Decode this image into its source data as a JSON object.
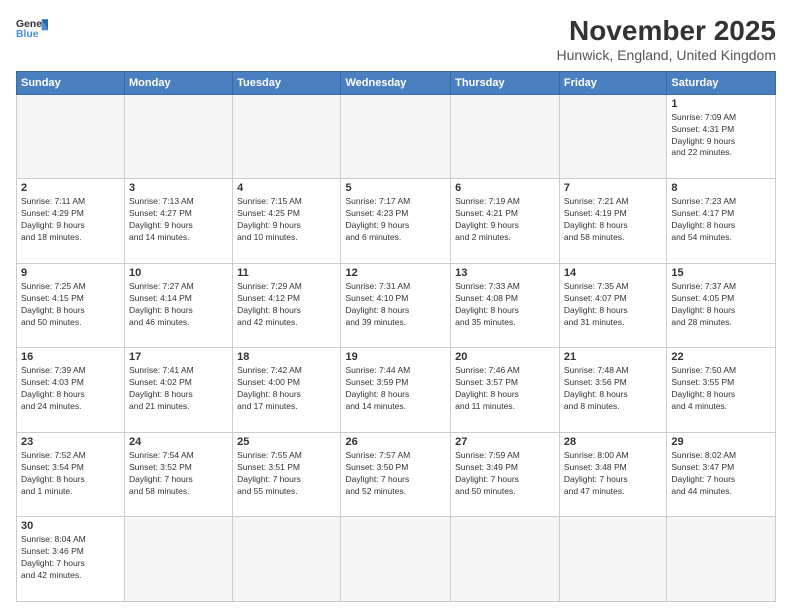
{
  "header": {
    "logo_general": "General",
    "logo_blue": "Blue",
    "title": "November 2025",
    "subtitle": "Hunwick, England, United Kingdom"
  },
  "weekdays": [
    "Sunday",
    "Monday",
    "Tuesday",
    "Wednesday",
    "Thursday",
    "Friday",
    "Saturday"
  ],
  "weeks": [
    [
      {
        "day": "",
        "info": ""
      },
      {
        "day": "",
        "info": ""
      },
      {
        "day": "",
        "info": ""
      },
      {
        "day": "",
        "info": ""
      },
      {
        "day": "",
        "info": ""
      },
      {
        "day": "",
        "info": ""
      },
      {
        "day": "1",
        "info": "Sunrise: 7:09 AM\nSunset: 4:31 PM\nDaylight: 9 hours\nand 22 minutes."
      }
    ],
    [
      {
        "day": "2",
        "info": "Sunrise: 7:11 AM\nSunset: 4:29 PM\nDaylight: 9 hours\nand 18 minutes."
      },
      {
        "day": "3",
        "info": "Sunrise: 7:13 AM\nSunset: 4:27 PM\nDaylight: 9 hours\nand 14 minutes."
      },
      {
        "day": "4",
        "info": "Sunrise: 7:15 AM\nSunset: 4:25 PM\nDaylight: 9 hours\nand 10 minutes."
      },
      {
        "day": "5",
        "info": "Sunrise: 7:17 AM\nSunset: 4:23 PM\nDaylight: 9 hours\nand 6 minutes."
      },
      {
        "day": "6",
        "info": "Sunrise: 7:19 AM\nSunset: 4:21 PM\nDaylight: 9 hours\nand 2 minutes."
      },
      {
        "day": "7",
        "info": "Sunrise: 7:21 AM\nSunset: 4:19 PM\nDaylight: 8 hours\nand 58 minutes."
      },
      {
        "day": "8",
        "info": "Sunrise: 7:23 AM\nSunset: 4:17 PM\nDaylight: 8 hours\nand 54 minutes."
      }
    ],
    [
      {
        "day": "9",
        "info": "Sunrise: 7:25 AM\nSunset: 4:15 PM\nDaylight: 8 hours\nand 50 minutes."
      },
      {
        "day": "10",
        "info": "Sunrise: 7:27 AM\nSunset: 4:14 PM\nDaylight: 8 hours\nand 46 minutes."
      },
      {
        "day": "11",
        "info": "Sunrise: 7:29 AM\nSunset: 4:12 PM\nDaylight: 8 hours\nand 42 minutes."
      },
      {
        "day": "12",
        "info": "Sunrise: 7:31 AM\nSunset: 4:10 PM\nDaylight: 8 hours\nand 39 minutes."
      },
      {
        "day": "13",
        "info": "Sunrise: 7:33 AM\nSunset: 4:08 PM\nDaylight: 8 hours\nand 35 minutes."
      },
      {
        "day": "14",
        "info": "Sunrise: 7:35 AM\nSunset: 4:07 PM\nDaylight: 8 hours\nand 31 minutes."
      },
      {
        "day": "15",
        "info": "Sunrise: 7:37 AM\nSunset: 4:05 PM\nDaylight: 8 hours\nand 28 minutes."
      }
    ],
    [
      {
        "day": "16",
        "info": "Sunrise: 7:39 AM\nSunset: 4:03 PM\nDaylight: 8 hours\nand 24 minutes."
      },
      {
        "day": "17",
        "info": "Sunrise: 7:41 AM\nSunset: 4:02 PM\nDaylight: 8 hours\nand 21 minutes."
      },
      {
        "day": "18",
        "info": "Sunrise: 7:42 AM\nSunset: 4:00 PM\nDaylight: 8 hours\nand 17 minutes."
      },
      {
        "day": "19",
        "info": "Sunrise: 7:44 AM\nSunset: 3:59 PM\nDaylight: 8 hours\nand 14 minutes."
      },
      {
        "day": "20",
        "info": "Sunrise: 7:46 AM\nSunset: 3:57 PM\nDaylight: 8 hours\nand 11 minutes."
      },
      {
        "day": "21",
        "info": "Sunrise: 7:48 AM\nSunset: 3:56 PM\nDaylight: 8 hours\nand 8 minutes."
      },
      {
        "day": "22",
        "info": "Sunrise: 7:50 AM\nSunset: 3:55 PM\nDaylight: 8 hours\nand 4 minutes."
      }
    ],
    [
      {
        "day": "23",
        "info": "Sunrise: 7:52 AM\nSunset: 3:54 PM\nDaylight: 8 hours\nand 1 minute."
      },
      {
        "day": "24",
        "info": "Sunrise: 7:54 AM\nSunset: 3:52 PM\nDaylight: 7 hours\nand 58 minutes."
      },
      {
        "day": "25",
        "info": "Sunrise: 7:55 AM\nSunset: 3:51 PM\nDaylight: 7 hours\nand 55 minutes."
      },
      {
        "day": "26",
        "info": "Sunrise: 7:57 AM\nSunset: 3:50 PM\nDaylight: 7 hours\nand 52 minutes."
      },
      {
        "day": "27",
        "info": "Sunrise: 7:59 AM\nSunset: 3:49 PM\nDaylight: 7 hours\nand 50 minutes."
      },
      {
        "day": "28",
        "info": "Sunrise: 8:00 AM\nSunset: 3:48 PM\nDaylight: 7 hours\nand 47 minutes."
      },
      {
        "day": "29",
        "info": "Sunrise: 8:02 AM\nSunset: 3:47 PM\nDaylight: 7 hours\nand 44 minutes."
      }
    ],
    [
      {
        "day": "30",
        "info": "Sunrise: 8:04 AM\nSunset: 3:46 PM\nDaylight: 7 hours\nand 42 minutes."
      },
      {
        "day": "",
        "info": ""
      },
      {
        "day": "",
        "info": ""
      },
      {
        "day": "",
        "info": ""
      },
      {
        "day": "",
        "info": ""
      },
      {
        "day": "",
        "info": ""
      },
      {
        "day": "",
        "info": ""
      }
    ]
  ]
}
